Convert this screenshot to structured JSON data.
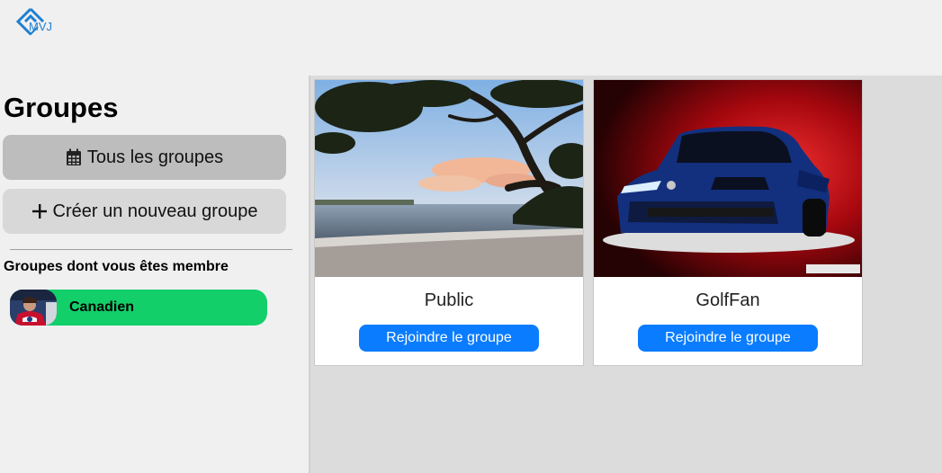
{
  "header": {
    "logo_text": "MVJ",
    "logo_icon": "diamond-logo-icon"
  },
  "sidebar": {
    "title": "Groupes",
    "all_groups_label": "Tous les groupes",
    "all_groups_icon": "calendar-icon",
    "create_group_label": "Créer un nouveau groupe",
    "create_group_icon": "plus-icon",
    "member_heading": "Groupes dont vous êtes membre",
    "member_groups": [
      {
        "name": "Canadien",
        "avatar": "hockey-player-avatar"
      }
    ]
  },
  "groups": [
    {
      "name": "Public",
      "image": "beach-sunset-tree-image",
      "join_label": "Rejoindre le groupe"
    },
    {
      "name": "GolfFan",
      "image": "blue-golf-car-image",
      "join_label": "Rejoindre le groupe"
    }
  ],
  "colors": {
    "join_button": "#0a7cff",
    "member_pill": "#12cf6a",
    "selected_sidebar_button": "#bdbdbd",
    "sidebar_button": "#d8d8d8",
    "content_background": "#dcdcdc"
  }
}
